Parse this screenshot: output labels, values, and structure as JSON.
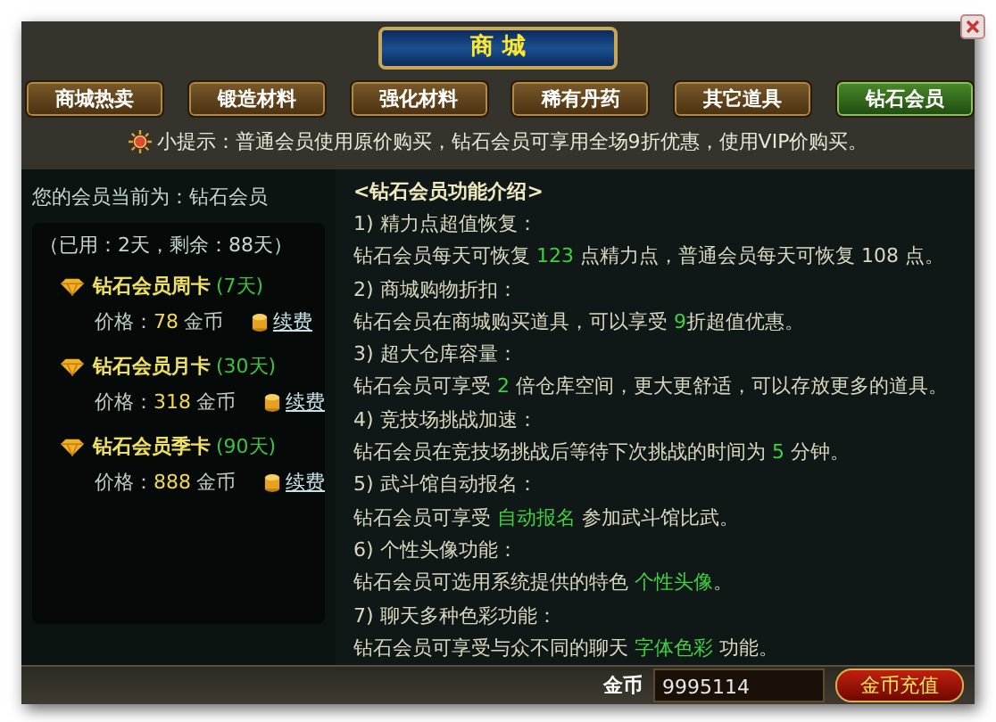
{
  "title": "商 城",
  "tabs": [
    {
      "label": "商城热卖",
      "selected": false
    },
    {
      "label": "锻造材料",
      "selected": false
    },
    {
      "label": "强化材料",
      "selected": false
    },
    {
      "label": "稀有丹药",
      "selected": false
    },
    {
      "label": "其它道具",
      "selected": false
    },
    {
      "label": "钻石会员",
      "selected": true
    }
  ],
  "tip": "小提示：普通会员使用原价购买，钻石会员可享用全场9折优惠，使用VIP价购买。",
  "membership": {
    "current": "您的会员当前为：钻石会员",
    "usage": "（已用：2天，剩余：88天）",
    "cards": [
      {
        "name": "钻石会员周卡",
        "duration": "(7天)",
        "price_label": "价格：",
        "price": "78",
        "unit": "金币",
        "renew": "续费"
      },
      {
        "name": "钻石会员月卡",
        "duration": "(30天)",
        "price_label": "价格：",
        "price": "318",
        "unit": "金币",
        "renew": "续费"
      },
      {
        "name": "钻石会员季卡",
        "duration": "(90天)",
        "price_label": "价格：",
        "price": "888",
        "unit": "金币",
        "renew": "续费"
      }
    ]
  },
  "intro": {
    "heading": "<钻石会员功能介绍>",
    "items": [
      {
        "title": "1) 精力点超值恢复：",
        "body": [
          {
            "text": "钻石会员每天可恢复 ",
            "highlight": false
          },
          {
            "text": "123",
            "highlight": true
          },
          {
            "text": " 点精力点，普通会员每天可恢复 108 点。",
            "highlight": false
          }
        ]
      },
      {
        "title": "2) 商城购物折扣：",
        "body": [
          {
            "text": "钻石会员在商城购买道具，可以享受 ",
            "highlight": false
          },
          {
            "text": "9",
            "highlight": true
          },
          {
            "text": "折超值优惠。",
            "highlight": false
          }
        ]
      },
      {
        "title": "3) 超大仓库容量：",
        "body": [
          {
            "text": "钻石会员可享受 ",
            "highlight": false
          },
          {
            "text": "2",
            "highlight": true
          },
          {
            "text": " 倍仓库空间，更大更舒适，可以存放更多的道具。",
            "highlight": false
          }
        ]
      },
      {
        "title": "4) 竞技场挑战加速：",
        "body": [
          {
            "text": "钻石会员在竞技场挑战后等待下次挑战的时间为 ",
            "highlight": false
          },
          {
            "text": "5",
            "highlight": true
          },
          {
            "text": " 分钟。",
            "highlight": false
          }
        ]
      },
      {
        "title": "5) 武斗馆自动报名：",
        "body": [
          {
            "text": "钻石会员可享受 ",
            "highlight": false
          },
          {
            "text": "自动报名",
            "highlight": true
          },
          {
            "text": " 参加武斗馆比武。",
            "highlight": false
          }
        ]
      },
      {
        "title": "6) 个性头像功能：",
        "body": [
          {
            "text": "钻石会员可选用系统提供的特色 ",
            "highlight": false
          },
          {
            "text": "个性头像",
            "highlight": true
          },
          {
            "text": "。",
            "highlight": false
          }
        ]
      },
      {
        "title": "7) 聊天多种色彩功能：",
        "body": [
          {
            "text": "钻石会员可享受与众不同的聊天 ",
            "highlight": false
          },
          {
            "text": "字体色彩",
            "highlight": true
          },
          {
            "text": " 功能。",
            "highlight": false
          }
        ]
      }
    ]
  },
  "footer": {
    "gold_label": "金币",
    "gold_value": "9995114",
    "recharge": "金币充值"
  }
}
